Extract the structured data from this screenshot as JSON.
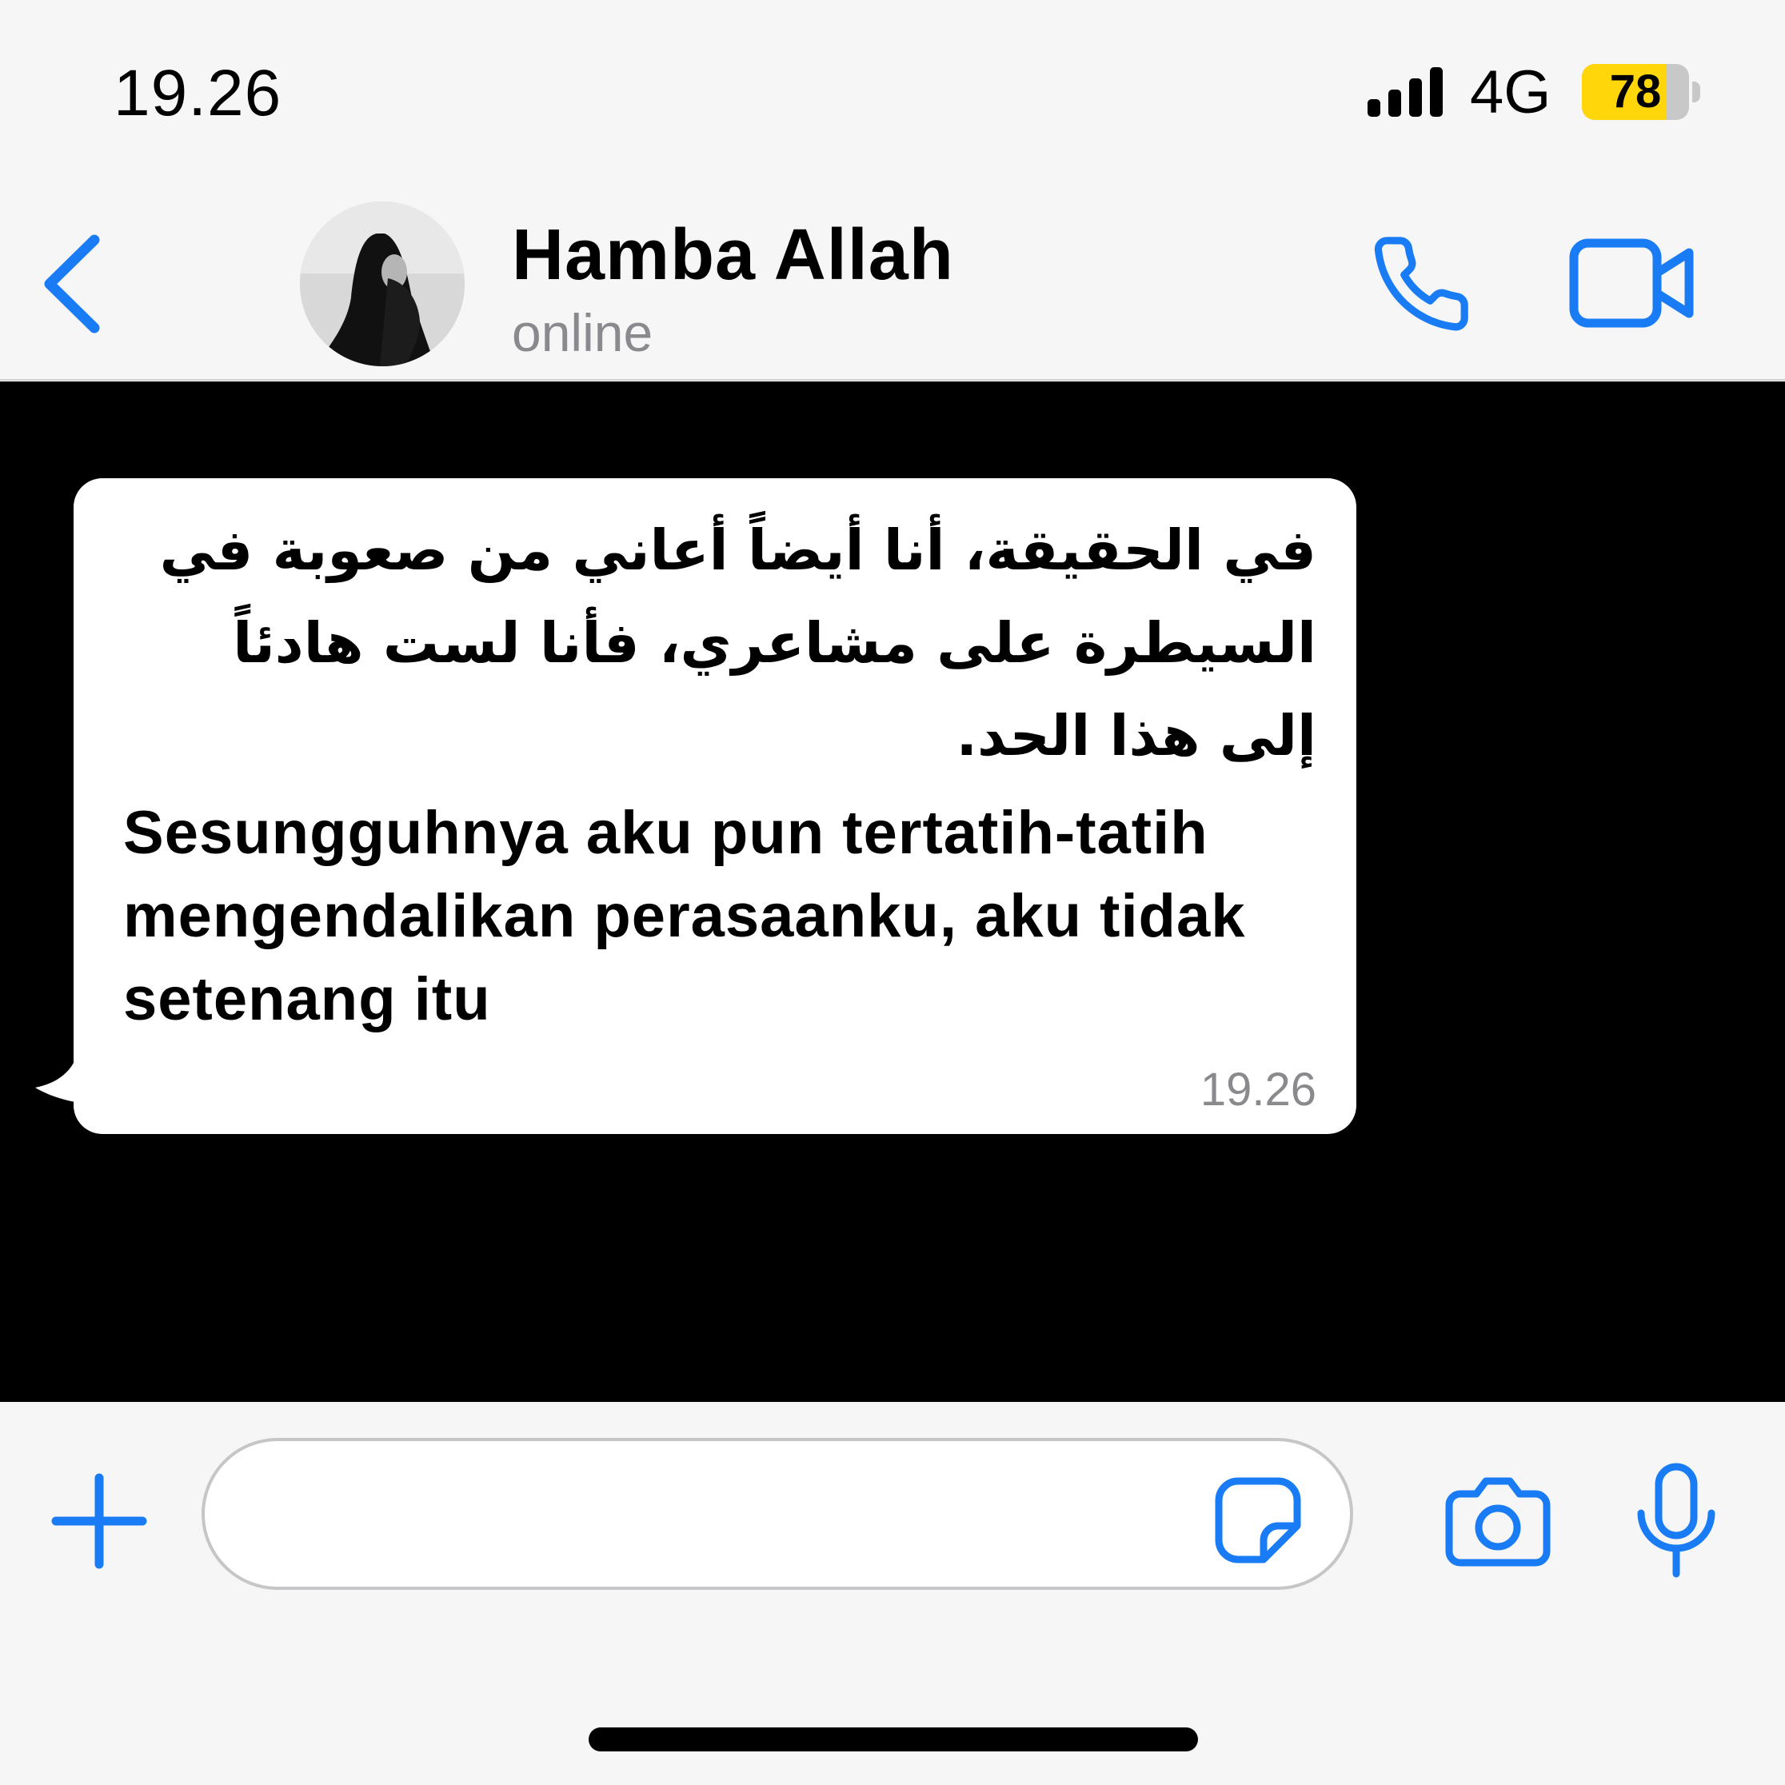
{
  "status_bar": {
    "time": "19.26",
    "network": "4G",
    "battery_level": "78",
    "battery_fraction": 0.78,
    "signal_bars": 4
  },
  "header": {
    "contact_name": "Hamba Allah",
    "contact_status": "online",
    "back_icon": "chevron-left-icon",
    "call_icon": "phone-icon",
    "video_icon": "video-camera-icon"
  },
  "message": {
    "text_arabic": "في الحقيقة، أنا أيضاً أعاني من صعوبة في السيطرة على مشاعري، فأنا لست هادئاً إلى هذا الحد.",
    "text_latin": "Sesungguhnya aku pun tertatih-tatih mengendalikan perasaanku, aku tidak setenang itu",
    "time": "19.26"
  },
  "input": {
    "value": "",
    "placeholder": ""
  },
  "colors": {
    "accent": "#1a7cf5",
    "battery": "#ffd60a",
    "chat_background": "#000000",
    "bubble": "#ffffff",
    "secondary_text": "#8a8a8e"
  }
}
